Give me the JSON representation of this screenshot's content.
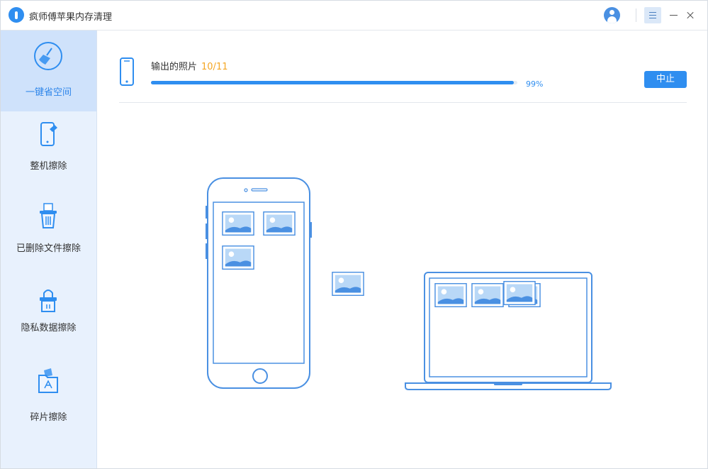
{
  "app": {
    "title": "疯师傅苹果内存清理"
  },
  "window_controls": {
    "icons": [
      "user-icon",
      "menu-icon",
      "minimize-icon",
      "close-icon"
    ]
  },
  "sidebar": {
    "items": [
      {
        "label": "一键省空间",
        "icon": "broom-icon",
        "active": true
      },
      {
        "label": "整机擦除",
        "icon": "phone-erase-icon",
        "active": false
      },
      {
        "label": "已删除文件擦除",
        "icon": "trash-file-icon",
        "active": false
      },
      {
        "label": "隐私数据擦除",
        "icon": "privacy-lock-icon",
        "active": false
      },
      {
        "label": "碎片擦除",
        "icon": "fragment-folder-icon",
        "active": false
      }
    ]
  },
  "task": {
    "label": "输出的照片",
    "count": "10/11",
    "progress_percent_text": "99%",
    "progress_value": 0.99,
    "stop_label": "中止"
  },
  "theme": {
    "accent": "#2f8ef0",
    "sidebar_bg": "#e8f1fd",
    "active_bg": "#cfe2fb",
    "count_color": "#f5a623"
  }
}
